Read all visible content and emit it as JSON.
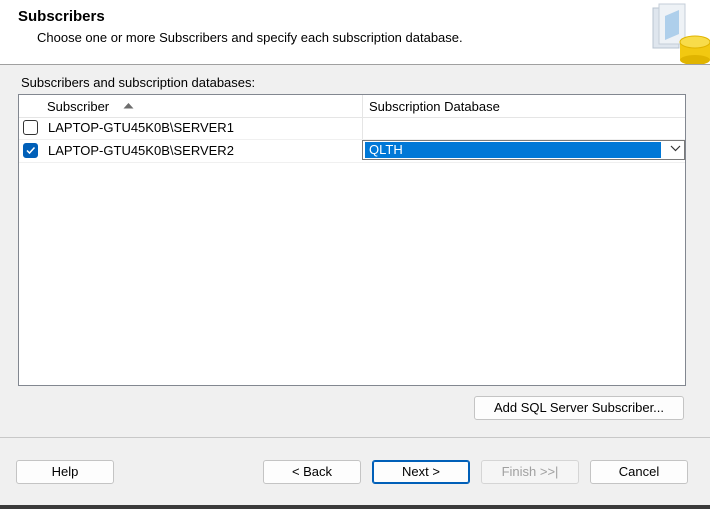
{
  "header": {
    "title": "Subscribers",
    "subtitle": "Choose one or more Subscribers and specify each subscription database."
  },
  "grid": {
    "label": "Subscribers and subscription databases:",
    "columns": [
      "Subscriber",
      "Subscription Database"
    ],
    "sort_column": "Subscriber",
    "rows": [
      {
        "subscriber": "LAPTOP-GTU45K0B\\SERVER1",
        "checked": false,
        "database": ""
      },
      {
        "subscriber": "LAPTOP-GTU45K0B\\SERVER2",
        "checked": true,
        "database": "QLTH"
      }
    ]
  },
  "actions": {
    "add_subscriber": "Add SQL Server Subscriber..."
  },
  "footer": {
    "help": "Help",
    "back": "< Back",
    "next": "Next >",
    "finish": "Finish >>|",
    "cancel": "Cancel"
  },
  "colors": {
    "accent": "#005fb8",
    "selection": "#0078d7"
  }
}
